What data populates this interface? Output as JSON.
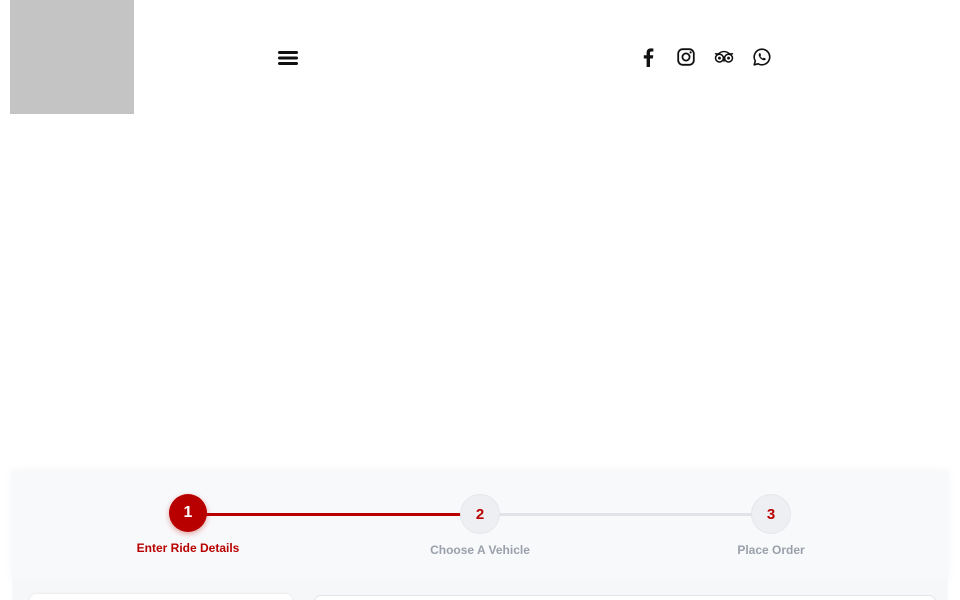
{
  "header": {
    "logo_icon": "image-placeholder",
    "menu_icon": "hamburger-icon",
    "social_icons": [
      "facebook-icon",
      "instagram-icon",
      "tripadvisor-icon",
      "whatsapp-icon"
    ]
  },
  "stepper": {
    "accent_color": "#b80000",
    "inactive_color": "#9aa0ab",
    "current_step": 1,
    "steps": [
      {
        "number": "1",
        "label": "Enter Ride Details"
      },
      {
        "number": "2",
        "label": "Choose A Vehicle"
      },
      {
        "number": "3",
        "label": "Place Order"
      }
    ]
  }
}
